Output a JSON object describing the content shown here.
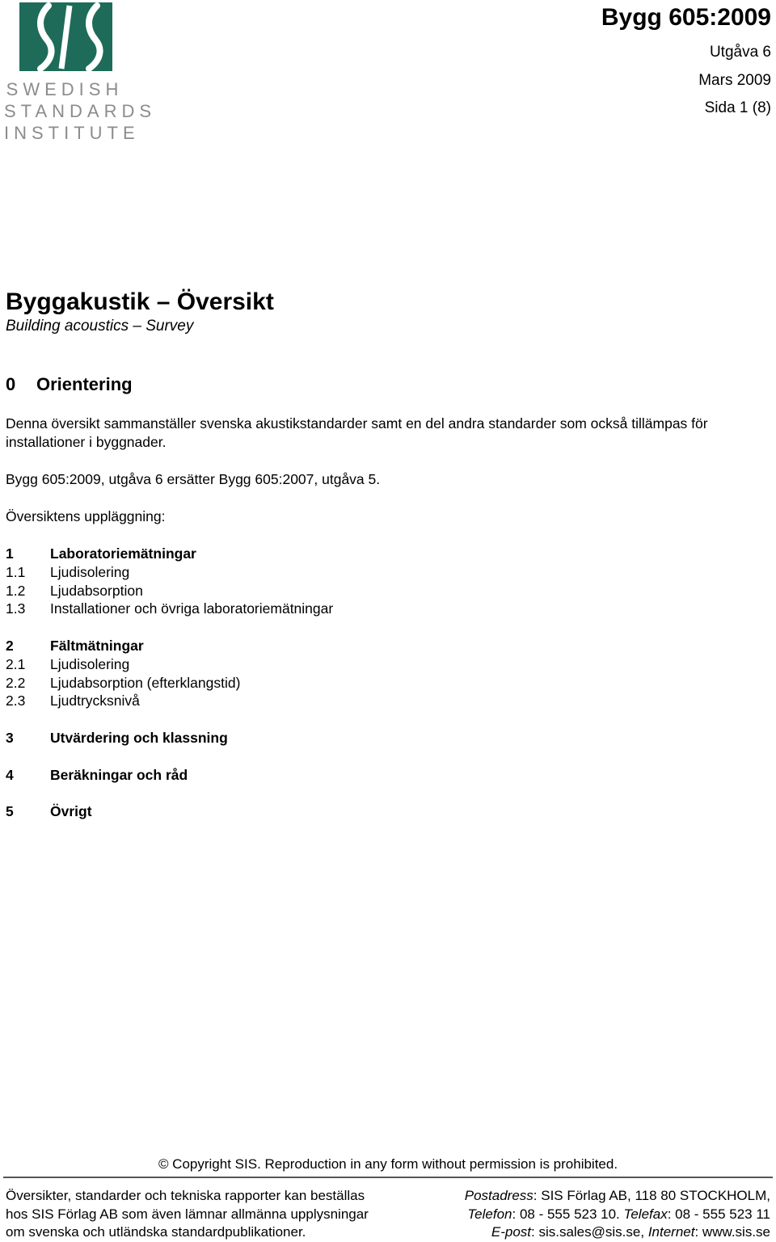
{
  "logo": {
    "brand_color": "#1e6b5a",
    "text_color": "#8c8c8c",
    "lines": [
      "SWEDISH",
      "STANDARDS",
      "INSTITUTE"
    ]
  },
  "header": {
    "doc_id": "Bygg 605:2009",
    "edition": "Utgåva 6",
    "date": "Mars 2009",
    "page": "Sida 1 (8)"
  },
  "title": {
    "main": "Byggakustik – Översikt",
    "english": "Building acoustics – Survey"
  },
  "section0": {
    "number": "0",
    "heading": "Orientering",
    "paragraphs": [
      "Denna översikt sammanställer svenska akustikstandarder samt en del andra standarder som också tillämpas för installationer i byggnader.",
      "Bygg 605:2009, utgåva 6 ersätter Bygg 605:2007, utgåva 5.",
      "Översiktens uppläggning:"
    ]
  },
  "toc": {
    "groups": [
      {
        "number": "1",
        "title": "Laboratoriemätningar",
        "items": [
          {
            "number": "1.1",
            "title": "Ljudisolering"
          },
          {
            "number": "1.2",
            "title": "Ljudabsorption"
          },
          {
            "number": "1.3",
            "title": "Installationer och övriga laboratoriemätningar"
          }
        ]
      },
      {
        "number": "2",
        "title": "Fältmätningar",
        "items": [
          {
            "number": "2.1",
            "title": "Ljudisolering"
          },
          {
            "number": "2.2",
            "title": "Ljudabsorption (efterklangstid)"
          },
          {
            "number": "2.3",
            "title": "Ljudtrycksnivå"
          }
        ]
      },
      {
        "number": "3",
        "title": "Utvärdering och klassning",
        "items": []
      },
      {
        "number": "4",
        "title": "Beräkningar och råd",
        "items": []
      },
      {
        "number": "5",
        "title": "Övrigt",
        "items": []
      }
    ]
  },
  "footer": {
    "copyright": "© Copyright SIS. Reproduction in any form without permission is prohibited.",
    "left_lines": [
      "Översikter, standarder och tekniska rapporter kan beställas",
      "hos SIS Förlag AB som även lämnar allmänna upplysningar",
      "om svenska och utländska standardpublikationer."
    ],
    "postal_label": "Postadress",
    "postal_value": ": SIS Förlag AB, 118 80 STOCKHOLM,",
    "phone_label": "Telefon",
    "phone_value": ": 08 - 555 523 10. ",
    "fax_label": "Telefax",
    "fax_value": ": 08 - 555 523 11",
    "email_label": "E-post",
    "email_value": "sis.sales@sis.se",
    "internet_label": "Internet",
    "internet_value": "www.sis.se"
  }
}
